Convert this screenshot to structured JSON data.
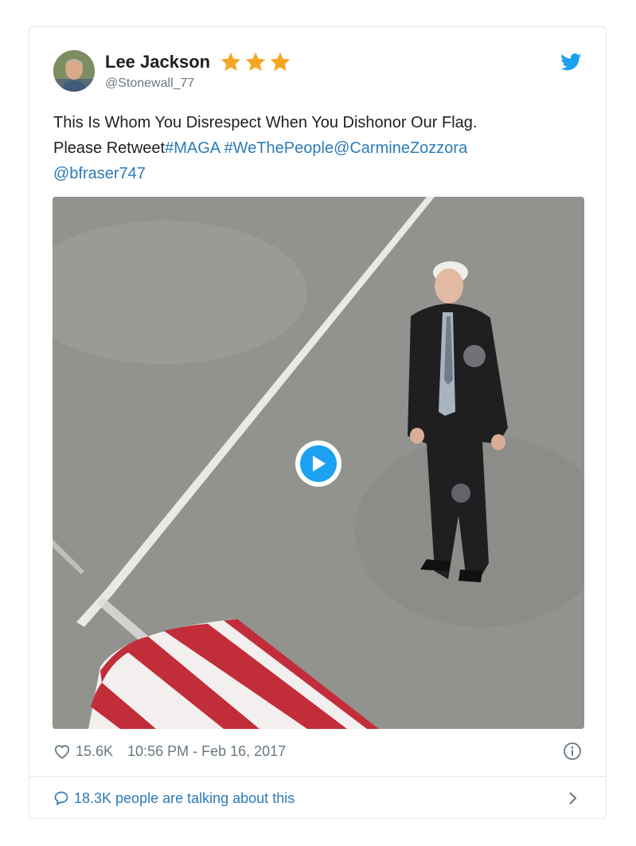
{
  "tweet": {
    "author": {
      "name": "Lee Jackson",
      "handle": "@Stonewall_77"
    },
    "text": {
      "plain": "This Is Whom You Disrespect When You Dishonor Our Flag.\nPlease Retweet",
      "tag_maga": "#MAGA",
      "tag_wethepeople": "#WeThePeople",
      "mention_carmine": "@CarmineZozzora",
      "mention_bfraser": "@bfraser747"
    },
    "likes": "15.6K",
    "timestamp": "10:56 PM - Feb 16, 2017",
    "talking": "18.3K people are talking about this"
  },
  "icons": {
    "brand": "twitter-bird-icon",
    "stars": "star-icon",
    "play": "play-icon",
    "like": "heart-icon",
    "info": "info-icon",
    "reply": "speech-bubble-icon",
    "more": "chevron-right-icon"
  },
  "colors": {
    "link": "#2b7bb9",
    "twitter_blue": "#1da1f2",
    "star": "#f5a623",
    "text": "#1c2022",
    "muted": "#697882"
  }
}
